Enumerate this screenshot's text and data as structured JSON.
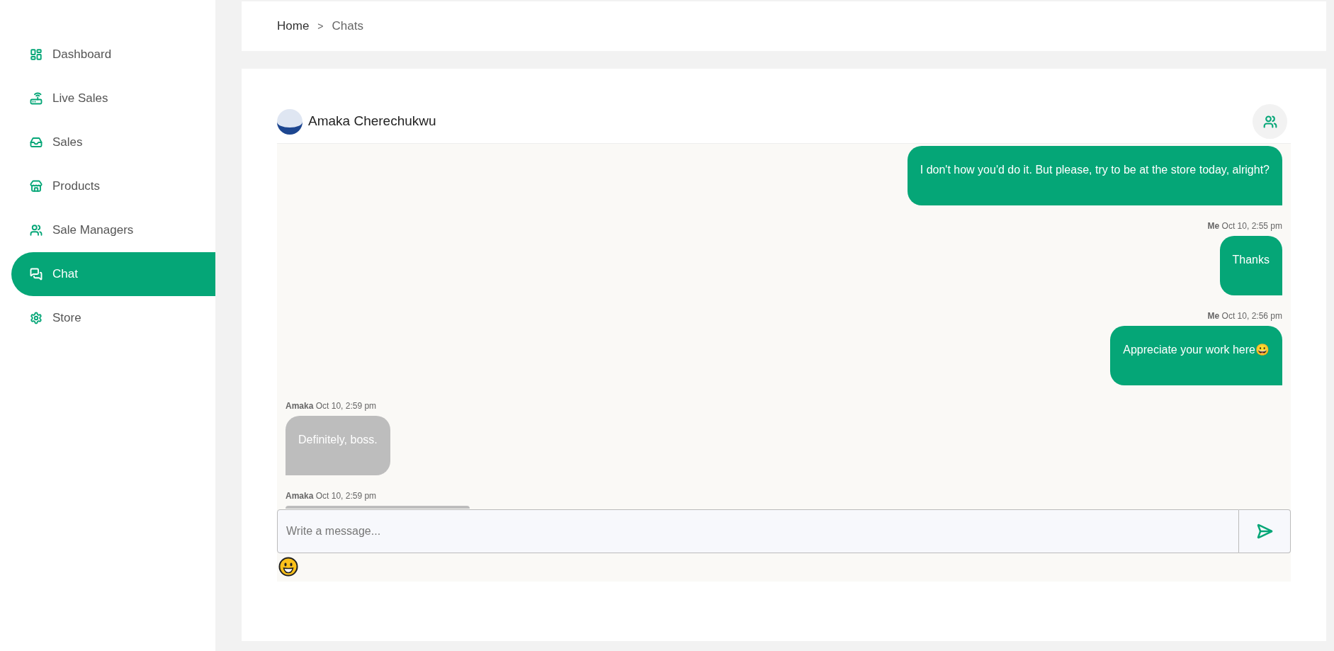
{
  "sidebar": {
    "items": [
      {
        "label": "Dashboard",
        "selected": false
      },
      {
        "label": "Live Sales",
        "selected": false
      },
      {
        "label": "Sales",
        "selected": false
      },
      {
        "label": "Products",
        "selected": false
      },
      {
        "label": "Sale Managers",
        "selected": false
      },
      {
        "label": "Chat",
        "selected": true
      },
      {
        "label": "Store",
        "selected": false
      }
    ]
  },
  "breadcrumb": {
    "items": [
      "Home",
      "Chats"
    ],
    "separator": ">"
  },
  "chat": {
    "contact": "Amaka Cherechukwu",
    "messages": [
      {
        "from_me": true,
        "text": "I don't how you'd do it. But please, try to be at the store today, alright?"
      },
      {
        "from_me": true,
        "sender": "Me",
        "time": "Oct 10, 2:55 pm",
        "text": "Thanks"
      },
      {
        "from_me": true,
        "sender": "Me",
        "time": "Oct 10, 2:56 pm",
        "text": "Appreciate your work here😀"
      },
      {
        "from_me": false,
        "sender": "Amaka",
        "time": "Oct 10, 2:59 pm",
        "text": "Definitely, boss."
      },
      {
        "from_me": false,
        "sender": "Amaka",
        "time": "Oct 10, 2:59 pm"
      }
    ],
    "input": {
      "placeholder": "Write a message..."
    }
  }
}
